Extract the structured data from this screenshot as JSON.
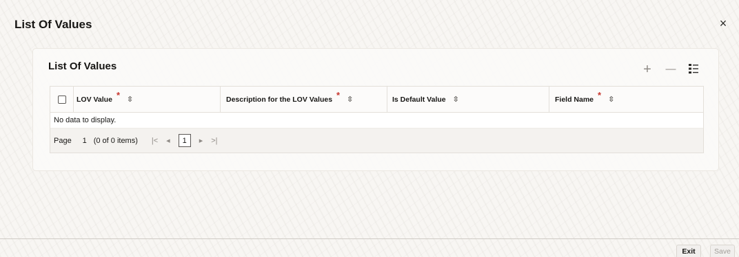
{
  "dialog": {
    "title": "List Of Values",
    "close_label": "×"
  },
  "panel": {
    "title": "List Of Values",
    "toolbar": {
      "add_icon": "plus-icon",
      "remove_icon": "minus-icon",
      "view_icon": "list-view-icon",
      "add_label": "+",
      "remove_label": "—"
    }
  },
  "grid": {
    "columns": [
      {
        "label": "LOV Value",
        "required": "*",
        "sort": "⇳"
      },
      {
        "label": "Description for the LOV Values",
        "required": "*",
        "sort": "⇳"
      },
      {
        "label": "Is Default Value",
        "required": "",
        "sort": "⇳"
      },
      {
        "label": "Field Name",
        "required": "*",
        "sort": "⇳"
      }
    ],
    "empty_message": "No data to display.",
    "pager": {
      "page_label": "Page",
      "page_value": "1",
      "items_summary": "(0 of 0 items)",
      "first": "|<",
      "prev": "◂",
      "current": "1",
      "next": "▸",
      "last": ">|"
    }
  },
  "footer": {
    "exit_label": "Exit",
    "save_label": "Save"
  },
  "colors": {
    "required": "#c7372f",
    "text": "#161513",
    "muted": "#8f8b86"
  }
}
